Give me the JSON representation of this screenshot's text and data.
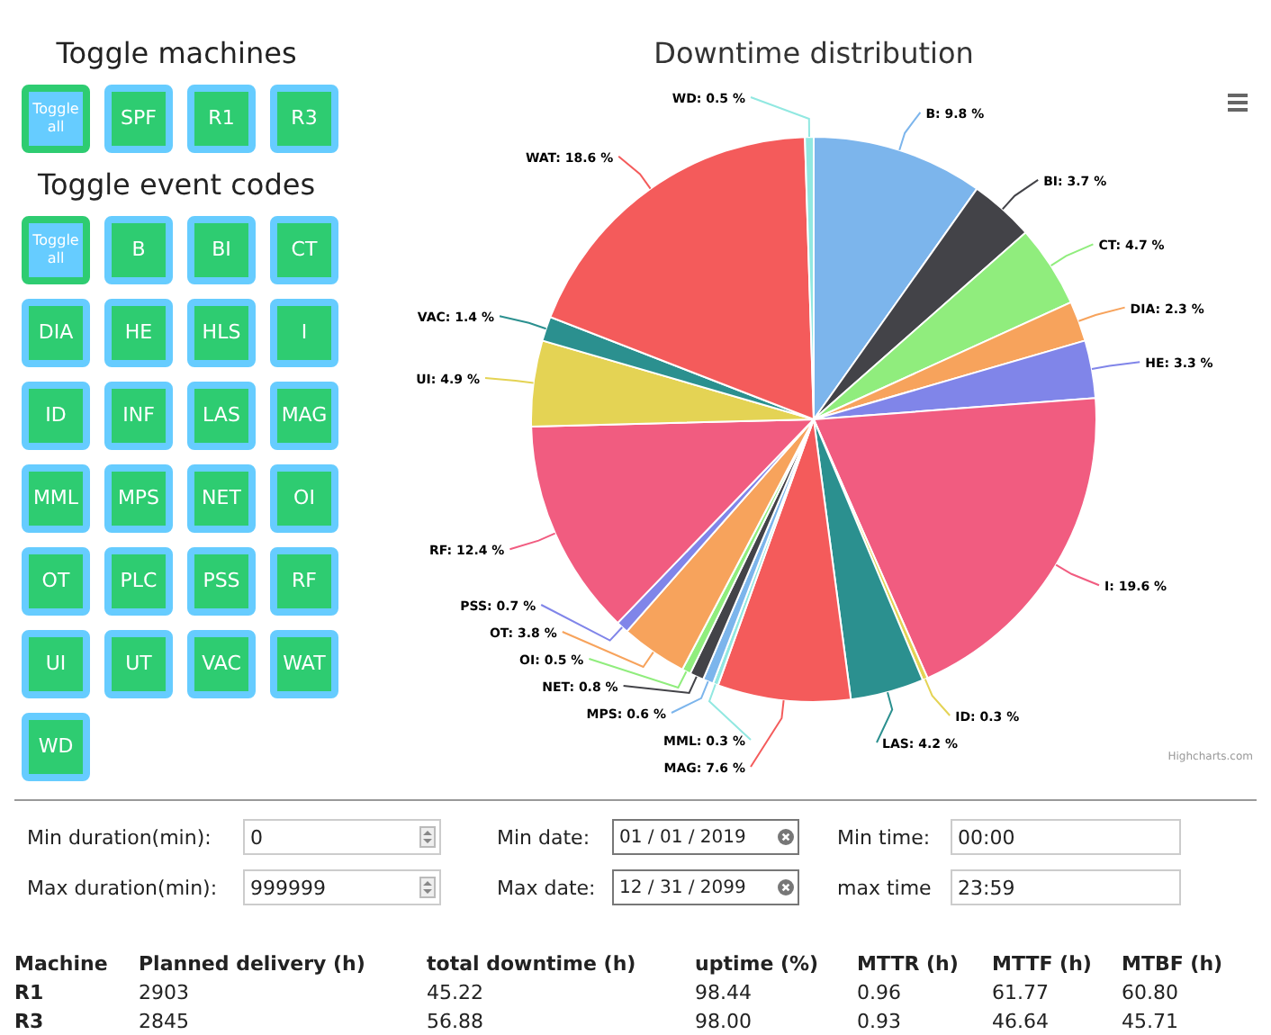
{
  "machines": {
    "title": "Toggle machines",
    "buttons": [
      {
        "label": "Toggle all",
        "kind": "toggle-all"
      },
      {
        "label": "SPF",
        "kind": "code"
      },
      {
        "label": "R1",
        "kind": "code"
      },
      {
        "label": "R3",
        "kind": "code"
      }
    ]
  },
  "event_codes": {
    "title": "Toggle event codes",
    "buttons": [
      {
        "label": "Toggle all",
        "kind": "toggle-all"
      },
      {
        "label": "B",
        "kind": "code"
      },
      {
        "label": "BI",
        "kind": "code"
      },
      {
        "label": "CT",
        "kind": "code"
      },
      {
        "label": "DIA",
        "kind": "code"
      },
      {
        "label": "HE",
        "kind": "code"
      },
      {
        "label": "HLS",
        "kind": "code"
      },
      {
        "label": "I",
        "kind": "code"
      },
      {
        "label": "ID",
        "kind": "code"
      },
      {
        "label": "INF",
        "kind": "code"
      },
      {
        "label": "LAS",
        "kind": "code"
      },
      {
        "label": "MAG",
        "kind": "code"
      },
      {
        "label": "MML",
        "kind": "code"
      },
      {
        "label": "MPS",
        "kind": "code"
      },
      {
        "label": "NET",
        "kind": "code"
      },
      {
        "label": "OI",
        "kind": "code"
      },
      {
        "label": "OT",
        "kind": "code"
      },
      {
        "label": "PLC",
        "kind": "code"
      },
      {
        "label": "PSS",
        "kind": "code"
      },
      {
        "label": "RF",
        "kind": "code"
      },
      {
        "label": "UI",
        "kind": "code"
      },
      {
        "label": "UT",
        "kind": "code"
      },
      {
        "label": "VAC",
        "kind": "code"
      },
      {
        "label": "WAT",
        "kind": "code"
      },
      {
        "label": "WD",
        "kind": "code"
      }
    ]
  },
  "chart": {
    "chart_data": {
      "type": "pie",
      "title": "Downtime distribution",
      "series": [
        {
          "values": [
            9.8,
            3.7,
            4.7,
            2.3,
            3.3,
            19.6,
            0.3,
            4.2,
            7.6,
            0.3,
            0.6,
            0.8,
            0.5,
            3.8,
            0.7,
            12.4,
            4.9,
            1.4,
            18.6,
            0.5
          ],
          "colors": [
            "#7cb5ec",
            "#434348",
            "#90ed7d",
            "#f7a35c",
            "#8085e9",
            "#f15c80",
            "#e4d354",
            "#2b908f",
            "#f45b5b",
            "#91e8e1",
            "#7cb5ec",
            "#434348",
            "#90ed7d",
            "#f7a35c",
            "#8085e9",
            "#f15c80",
            "#e4d354",
            "#2b908f",
            "#f45b5b",
            "#91e8e1"
          ]
        }
      ],
      "value_labels": [
        "B: 9.8 %",
        "BI: 3.7 %",
        "CT: 4.7 %",
        "DIA: 2.3 %",
        "HE: 3.3 %",
        "I: 19.6 %",
        "ID: 0.3 %",
        "LAS: 4.2 %",
        "MAG: 7.6 %",
        "MML: 0.3 %",
        "MPS: 0.6 %",
        "NET: 0.8 %",
        "OI: 0.5 %",
        "OT: 3.8 %",
        "PSS: 0.7 %",
        "RF: 12.4 %",
        "UI: 4.9 %",
        "VAC: 1.4 %",
        "WAT: 18.6 %",
        "WD: 0.5 %"
      ]
    },
    "credits": "Highcharts.com"
  },
  "filters": [
    [
      {
        "label": "Min duration(min):",
        "value": "0",
        "kind": "number"
      },
      {
        "label": "Min date:",
        "value": "01 / 01 / 2019",
        "kind": "date"
      },
      {
        "label": "Min time:",
        "value": "00:00",
        "kind": "time"
      }
    ],
    [
      {
        "label": "Max duration(min):",
        "value": "999999",
        "kind": "number"
      },
      {
        "label": "Max date:",
        "value": "12 / 31 / 2099",
        "kind": "date"
      },
      {
        "label": "max time",
        "value": "23:59",
        "kind": "time"
      }
    ]
  ],
  "table": {
    "columns": [
      "Machine",
      "Planned delivery (h)",
      "total downtime (h)",
      "uptime (%)",
      "MTTR (h)",
      "MTTF (h)",
      "MTBF (h)"
    ],
    "rows": [
      [
        "R1",
        "2903",
        "45.22",
        "98.44",
        "0.96",
        "61.77",
        "60.80"
      ],
      [
        "R3",
        "2845",
        "56.88",
        "98.00",
        "0.93",
        "46.64",
        "45.71"
      ]
    ]
  }
}
